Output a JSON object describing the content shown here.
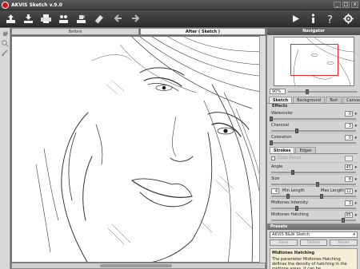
{
  "app": {
    "title": "AKVIS Sketch v.9.0"
  },
  "window_buttons": [
    "_",
    "□",
    "x"
  ],
  "toolbar": {
    "left_icons": [
      "open-icon",
      "save-icon",
      "print-icon",
      "share-icon",
      "batch-icon",
      "eraser-icon",
      "back-icon",
      "forward-icon"
    ],
    "right_icons": [
      "run-icon",
      "info-icon",
      "help-icon",
      "settings-icon"
    ]
  },
  "view_tabs": {
    "before": "Before",
    "after": "After ( Sketch )"
  },
  "navigator": {
    "title": "Navigator",
    "zoom": "90%"
  },
  "panel_tabs": [
    "Sketch",
    "Background",
    "Text",
    "Canvas"
  ],
  "effects": {
    "title": "Effects",
    "watercolor": {
      "label": "Watercolor",
      "value": "0",
      "level": 0.0
    },
    "charcoal": {
      "label": "Charcoal",
      "value": "3",
      "level": 0.3
    },
    "coloration": {
      "label": "Coloration",
      "value": "0",
      "level": 0.0
    }
  },
  "stroke_tabs": [
    "Strokes",
    "Edges"
  ],
  "strokes": {
    "color_pencil": "Color Pencil",
    "angle": {
      "label": "Angle",
      "value": "45",
      "level": 0.25
    },
    "size": {
      "label": "Size",
      "value": "8",
      "level": 0.55
    },
    "min_length_label": "Min Length",
    "min_length": "4",
    "max_length_label": "Max Length",
    "max_length": "12",
    "midtones_intensity": {
      "label": "Midtones Intensity",
      "value": "3",
      "level": 0.3
    },
    "midtones_hatching": {
      "label": "Midtones Hatching",
      "value": "85",
      "level": 0.85
    }
  },
  "presets": {
    "title": "Presets",
    "selected": "AKVIS B&W Sketch",
    "buttons": [
      "Save",
      "Delete",
      "Reset"
    ]
  },
  "help": {
    "title": "Midtones Hatching",
    "text": "The parameter Midtones Hatching defines the density of hatching in the midtone areas. It can be"
  },
  "colors": {
    "accent_red": "#dd1111",
    "panel": "#d4d4d4"
  }
}
